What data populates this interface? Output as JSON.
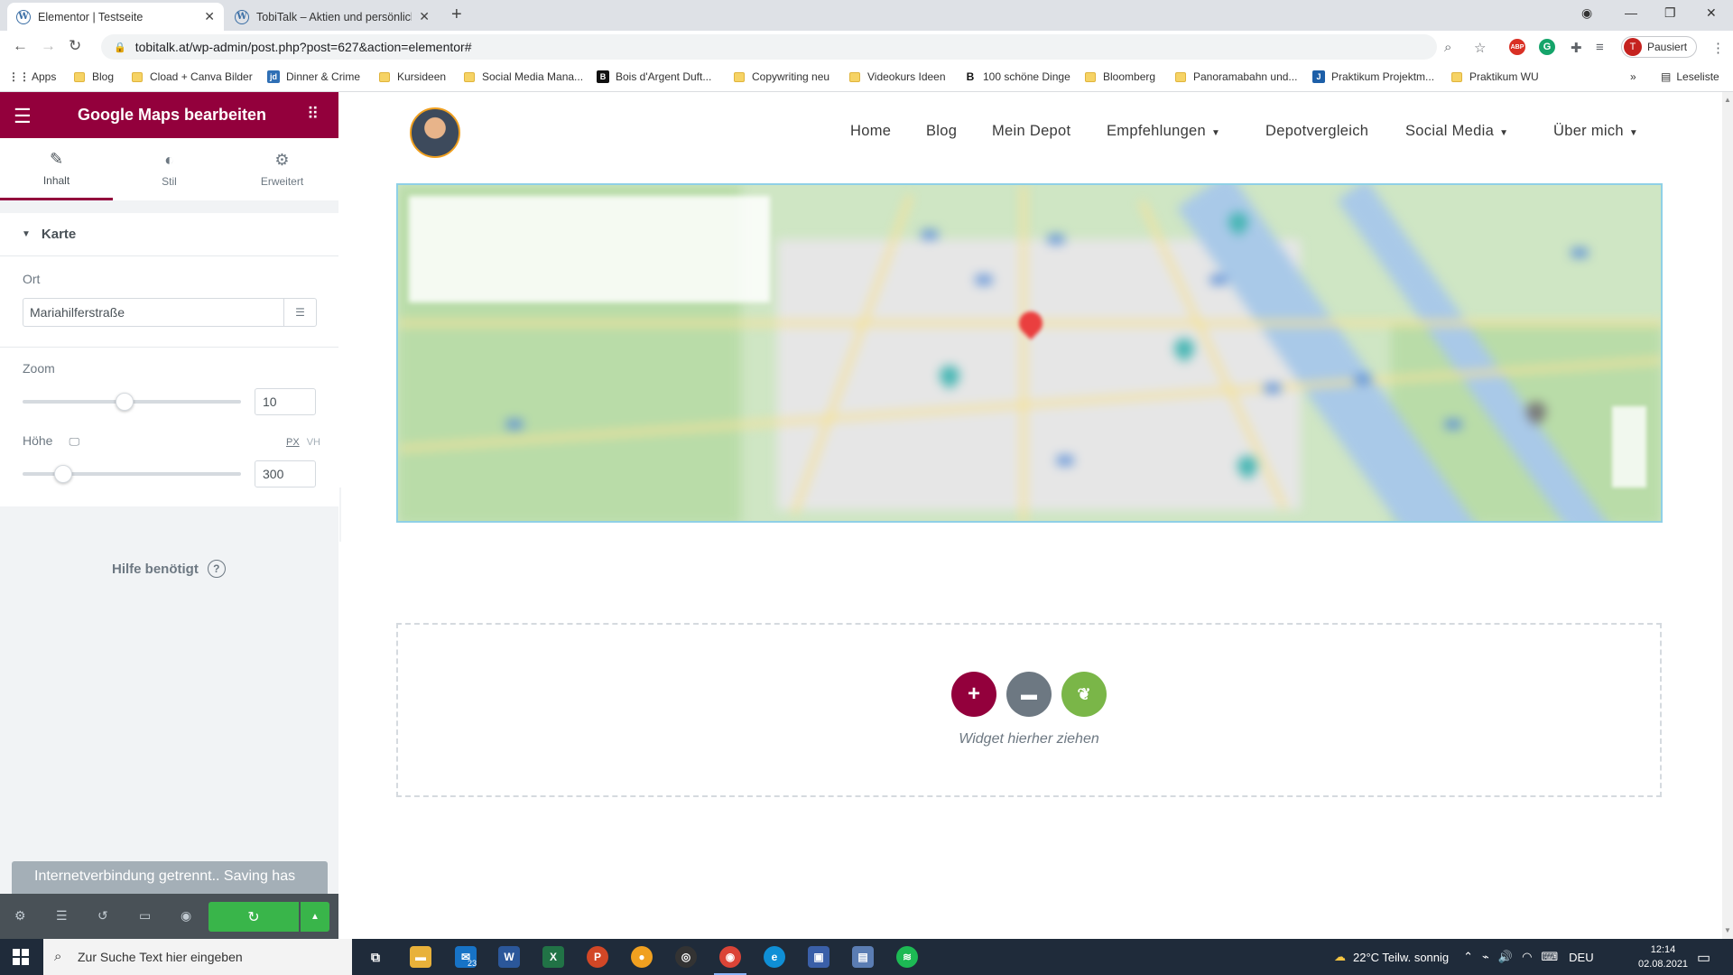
{
  "browser": {
    "tabs": [
      {
        "title": "Elementor | Testseite",
        "active": true
      },
      {
        "title": "TobiTalk – Aktien und persönlich...",
        "active": false
      }
    ],
    "url": "tobitalk.at/wp-admin/post.php?post=627&action=elementor#",
    "profile_status": "Pausiert",
    "profile_initial": "T",
    "bookmarks": [
      "Apps",
      "Blog",
      "Cload + Canva Bilder",
      "Dinner & Crime",
      "Kursideen",
      "Social Media Mana...",
      "Bois d'Argent Duft...",
      "Copywriting neu",
      "Videokurs Ideen",
      "100 schöne Dinge",
      "Bloomberg",
      "Panoramabahn und...",
      "Praktikum Projektm...",
      "Praktikum WU"
    ],
    "reading_list": "Leseliste"
  },
  "panel": {
    "title": "Google Maps bearbeiten",
    "tabs": [
      "Inhalt",
      "Stil",
      "Erweitert"
    ],
    "section": "Karte",
    "ort_label": "Ort",
    "ort_value": "Mariahilferstraße",
    "zoom_label": "Zoom",
    "zoom_value": "10",
    "zoom_level": 10,
    "hoehe_label": "Höhe",
    "hoehe_value": "300",
    "unit_px": "PX",
    "unit_vh": "VH",
    "help": "Hilfe benötigt",
    "toast": "Internetverbindung getrennt.. Saving has"
  },
  "site": {
    "nav": [
      {
        "label": "Home",
        "dropdown": false
      },
      {
        "label": "Blog",
        "dropdown": false
      },
      {
        "label": "Mein Depot",
        "dropdown": false
      },
      {
        "label": "Empfehlungen",
        "dropdown": true
      },
      {
        "label": "Depotvergleich",
        "dropdown": false
      },
      {
        "label": "Social Media",
        "dropdown": true
      },
      {
        "label": "Über mich",
        "dropdown": true
      }
    ],
    "drop_label": "Widget hierher ziehen"
  },
  "taskbar": {
    "search_placeholder": "Zur Suche Text hier eingeben",
    "weather": "22°C  Teilw. sonnig",
    "lang": "DEU",
    "time": "12:14",
    "date": "02.08.2021",
    "mail_badge": "23"
  },
  "colors": {
    "elementor_brand": "#93003c",
    "save_green": "#39b54a",
    "toast_gray": "#a4afb7",
    "taskbar": "#1f2b3a"
  }
}
